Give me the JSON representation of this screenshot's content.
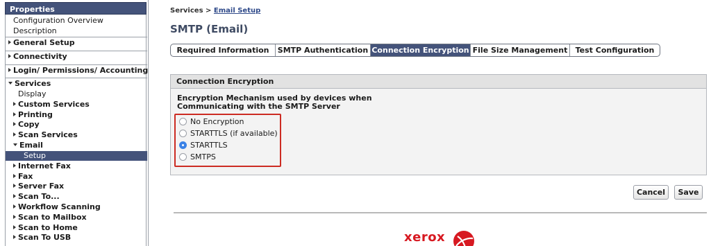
{
  "sidebar": {
    "header": "Properties",
    "top_items": [
      "Configuration Overview",
      "Description"
    ],
    "sections": [
      {
        "label": "General Setup"
      },
      {
        "label": "Connectivity"
      },
      {
        "label": "Login/ Permissions/ Accounting"
      }
    ],
    "services": {
      "label": "Services",
      "items": [
        "Display",
        "Custom Services",
        "Printing",
        "Copy",
        "Scan Services"
      ],
      "email_label": "Email",
      "email_child": "Setup",
      "after_items": [
        "Internet Fax",
        "Fax",
        "Server Fax",
        "Scan To...",
        "Workflow Scanning",
        "Scan to Mailbox",
        "Scan to Home",
        "Scan To USB"
      ]
    }
  },
  "breadcrumb": {
    "root": "Services",
    "separator": ">",
    "current": "Email Setup"
  },
  "page_title": "SMTP (Email)",
  "tabs": [
    {
      "label": "Required Information",
      "active": false
    },
    {
      "label": "SMTP Authentication",
      "active": false
    },
    {
      "label": "Connection Encryption",
      "active": true
    },
    {
      "label": "File Size Management",
      "active": false
    },
    {
      "label": "Test Configuration",
      "active": false
    }
  ],
  "panel": {
    "title": "Connection Encryption",
    "description_line1": "Encryption Mechanism used by devices when",
    "description_line2": "Communicating with the SMTP Server",
    "options": [
      "No Encryption",
      "STARTTLS (if available)",
      "STARTTLS",
      "SMTPS"
    ],
    "selected": "STARTTLS"
  },
  "buttons": {
    "cancel": "Cancel",
    "save": "Save"
  },
  "logo": {
    "text": "xerox",
    "icon": "xerox-ball-icon"
  },
  "colors": {
    "accent": "#44537a",
    "highlight": "#cc2b22",
    "radio": "#3b82e6",
    "brand": "#d71921"
  }
}
